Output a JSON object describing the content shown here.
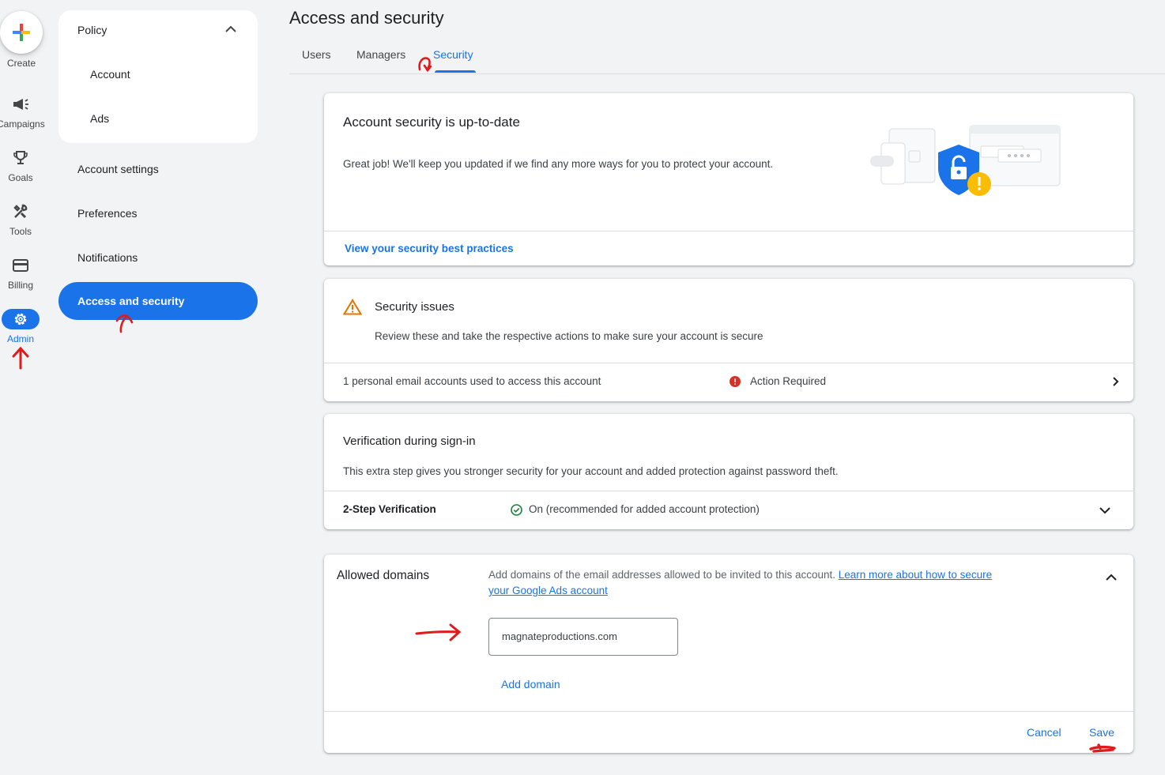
{
  "rail": {
    "create_label": "Create",
    "campaigns_label": "Campaigns",
    "goals_label": "Goals",
    "tools_label": "Tools",
    "billing_label": "Billing",
    "admin_label": "Admin"
  },
  "nav": {
    "policy_label": "Policy",
    "policy_items": [
      "Account",
      "Ads"
    ],
    "account_settings": "Account settings",
    "preferences": "Preferences",
    "notifications": "Notifications",
    "access_security": "Access and security"
  },
  "page": {
    "title": "Access and security",
    "tabs": [
      "Users",
      "Managers",
      "Security"
    ]
  },
  "security_status": {
    "title": "Account security is up-to-date",
    "body": "Great job! We'll keep you updated if we find any more ways for you to protect your account.",
    "link": "View your security best practices"
  },
  "issues": {
    "title": "Security issues",
    "subtitle": "Review these and take the respective actions to make sure your account is secure",
    "row_text": "1 personal email accounts used to access this account",
    "row_status": "Action Required"
  },
  "verification": {
    "title": "Verification during sign-in",
    "body": "This extra step gives you stronger security for your account and added protection against password theft.",
    "row_label": "2-Step Verification",
    "row_status": "On (recommended for added account protection)"
  },
  "domains": {
    "title": "Allowed domains",
    "description": "Add domains of the email addresses allowed to be invited to this account. ",
    "learn_more": "Learn more about how to secure your Google Ads account",
    "input_value": "magnateproductions.com",
    "add_domain": "Add domain",
    "cancel": "Cancel",
    "save": "Save"
  },
  "colors": {
    "accent": "#1a73e8",
    "warning": "#e37400",
    "error": "#d93025",
    "success": "#188038",
    "annotation": "#e01b1b"
  }
}
